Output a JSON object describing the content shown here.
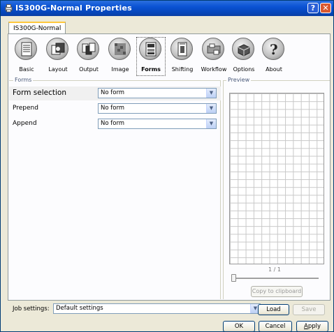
{
  "window": {
    "title": "IS300G-Normal Properties",
    "help_glyph": "?",
    "close_glyph": "✕"
  },
  "tab": {
    "label": "IS300G-Normal"
  },
  "toolbar": {
    "items": [
      {
        "label": "Basic",
        "icon": "document-icon"
      },
      {
        "label": "Layout",
        "icon": "layout-icon"
      },
      {
        "label": "Output",
        "icon": "output-icon"
      },
      {
        "label": "Image",
        "icon": "image-icon"
      },
      {
        "label": "Forms",
        "icon": "forms-icon",
        "active": true
      },
      {
        "label": "Shifting",
        "icon": "shifting-icon"
      },
      {
        "label": "Workflow",
        "icon": "workflow-icon"
      },
      {
        "label": "Options",
        "icon": "options-icon"
      },
      {
        "label": "About",
        "icon": "about-icon"
      }
    ]
  },
  "forms": {
    "group_label": "Forms",
    "rows": [
      {
        "label": "Form selection",
        "value": "No form"
      },
      {
        "label": "Prepend",
        "value": "No form"
      },
      {
        "label": "Append",
        "value": "No form"
      }
    ]
  },
  "preview": {
    "group_label": "Preview",
    "page_indicator": "1 / 1",
    "copy_label": "Copy to clipboard"
  },
  "job": {
    "label": "Job settings:",
    "value": "Default settings",
    "load_label": "Load",
    "save_label": "Save"
  },
  "buttons": {
    "ok": "OK",
    "cancel": "Cancel",
    "apply_rest": "pply",
    "apply_accel": "A"
  },
  "dropdown_arrow": "▼"
}
